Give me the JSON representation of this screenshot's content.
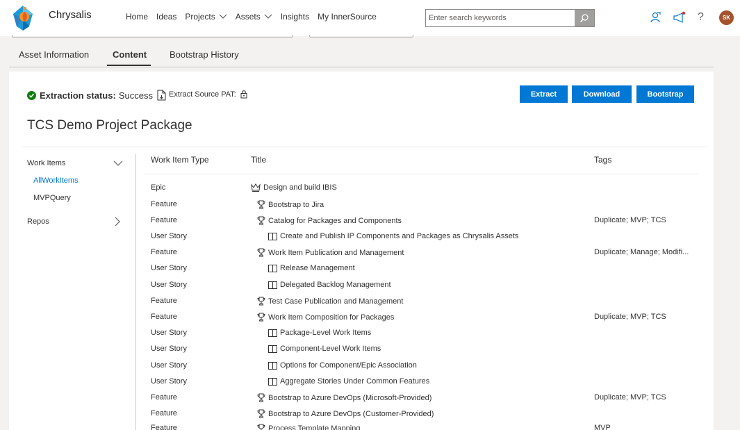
{
  "header": {
    "brand": "Chrysalis",
    "nav": [
      {
        "label": "Home",
        "dropdown": false
      },
      {
        "label": "Ideas",
        "dropdown": false
      },
      {
        "label": "Projects",
        "dropdown": true
      },
      {
        "label": "Assets",
        "dropdown": true
      },
      {
        "label": "Insights",
        "dropdown": false
      },
      {
        "label": "My InnerSource",
        "dropdown": false
      }
    ],
    "search_placeholder": "Enter search keywords",
    "avatar_initials": "SK",
    "help_glyph": "?"
  },
  "tabs": [
    "Asset Information",
    "Content",
    "Bootstrap History"
  ],
  "active_tab": "Content",
  "status": {
    "label": "Extraction status:",
    "value": "Success",
    "pat_label": "Extract Source PAT:"
  },
  "buttons": {
    "extract": "Extract",
    "download": "Download",
    "bootstrap": "Bootstrap"
  },
  "page_title": "TCS Demo Project Package",
  "left_panel": {
    "work_items": "Work Items",
    "sub_items": [
      "AllWorkItems",
      "MVPQuery"
    ],
    "repos": "Repos"
  },
  "table": {
    "headers": [
      "Work Item Type",
      "Title",
      "Tags"
    ],
    "rows": [
      {
        "type": "Epic",
        "title": "Design and build IBIS",
        "tags": "",
        "icon": "crown-icon"
      },
      {
        "type": "Feature",
        "title": "Bootstrap to Jira",
        "tags": "",
        "icon": "trophy-icon"
      },
      {
        "type": "Feature",
        "title": "Catalog for Packages and Components",
        "tags": "Duplicate; MVP; TCS",
        "icon": "trophy-icon"
      },
      {
        "type": "User Story",
        "title": "Create and Publish IP Components and Packages as Chrysalis Assets",
        "tags": "",
        "icon": "book-icon"
      },
      {
        "type": "Feature",
        "title": "Work Item Publication and Management",
        "tags": "Duplicate; Manage; Modifi...",
        "icon": "trophy-icon"
      },
      {
        "type": "User Story",
        "title": "Release Management",
        "tags": "",
        "icon": "book-icon"
      },
      {
        "type": "User Story",
        "title": "Delegated Backlog Management",
        "tags": "",
        "icon": "book-icon"
      },
      {
        "type": "Feature",
        "title": "Test Case Publication and Management",
        "tags": "",
        "icon": "trophy-icon"
      },
      {
        "type": "Feature",
        "title": "Work Item Composition for Packages",
        "tags": "Duplicate; MVP; TCS",
        "icon": "trophy-icon"
      },
      {
        "type": "User Story",
        "title": "Package-Level Work Items",
        "tags": "",
        "icon": "book-icon"
      },
      {
        "type": "User Story",
        "title": "Component-Level Work Items",
        "tags": "",
        "icon": "book-icon"
      },
      {
        "type": "User Story",
        "title": "Options for Component/Epic Association",
        "tags": "",
        "icon": "book-icon"
      },
      {
        "type": "User Story",
        "title": "Aggregate Stories Under Common Features",
        "tags": "",
        "icon": "book-icon"
      },
      {
        "type": "Feature",
        "title": "Bootstrap to Azure DevOps (Microsoft-Provided)",
        "tags": "Duplicate; MVP; TCS",
        "icon": "trophy-icon"
      },
      {
        "type": "Feature",
        "title": "Bootstrap to Azure DevOps (Customer-Provided)",
        "tags": "",
        "icon": "trophy-icon"
      },
      {
        "type": "Feature",
        "title": "Process Template Mapping",
        "tags": "MVP",
        "icon": "trophy-icon"
      }
    ]
  },
  "colors": {
    "primary": "#0078d4",
    "success": "#107c10",
    "link": "#0078d4",
    "avatar": "#a4532c"
  }
}
